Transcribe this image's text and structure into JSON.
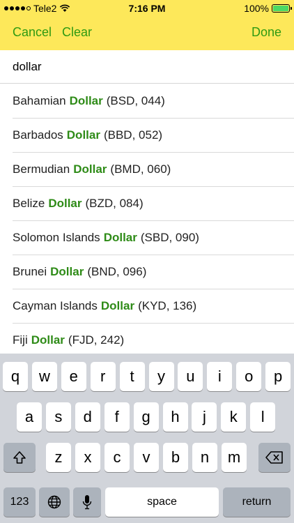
{
  "status": {
    "carrier": "Tele2",
    "time": "7:16 PM",
    "battery": "100%",
    "signal_bars_filled": 4,
    "signal_bars_total": 5
  },
  "nav": {
    "cancel_label": "Cancel",
    "clear_label": "Clear",
    "done_label": "Done"
  },
  "search": {
    "value": "dollar"
  },
  "results": [
    {
      "prefix": "Bahamian",
      "match": "Dollar",
      "suffix": "(BSD, 044)"
    },
    {
      "prefix": "Barbados",
      "match": "Dollar",
      "suffix": "(BBD, 052)"
    },
    {
      "prefix": "Bermudian",
      "match": "Dollar",
      "suffix": "(BMD, 060)"
    },
    {
      "prefix": "Belize",
      "match": "Dollar",
      "suffix": "(BZD, 084)"
    },
    {
      "prefix": "Solomon Islands",
      "match": "Dollar",
      "suffix": "(SBD, 090)"
    },
    {
      "prefix": "Brunei",
      "match": "Dollar",
      "suffix": "(BND, 096)"
    },
    {
      "prefix": "Cayman Islands",
      "match": "Dollar",
      "suffix": "(KYD, 136)"
    },
    {
      "prefix": "Fiji",
      "match": "Dollar",
      "suffix": "(FJD, 242)"
    }
  ],
  "keyboard": {
    "row1": [
      "q",
      "w",
      "e",
      "r",
      "t",
      "y",
      "u",
      "i",
      "o",
      "p"
    ],
    "row2": [
      "a",
      "s",
      "d",
      "f",
      "g",
      "h",
      "j",
      "k",
      "l"
    ],
    "row3": [
      "z",
      "x",
      "c",
      "v",
      "b",
      "n",
      "m"
    ],
    "numbers_label": "123",
    "space_label": "space",
    "return_label": "return",
    "icons": {
      "shift": "shift-icon",
      "delete": "backspace-icon",
      "globe": "globe-icon",
      "mic": "microphone-icon"
    }
  },
  "colors": {
    "nav_background": "#fde85a",
    "accent_green": "#2e9a12",
    "highlight_green": "#2e8b17",
    "keyboard_background": "#d1d4da"
  }
}
